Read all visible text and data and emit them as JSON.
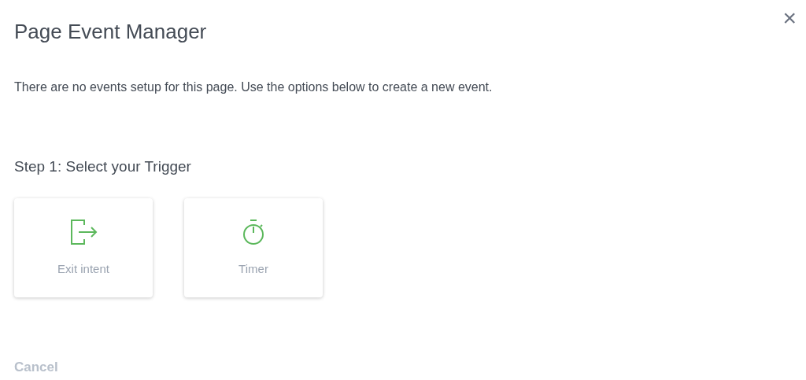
{
  "dialog": {
    "title": "Page Event Manager",
    "close": "×",
    "message": "There are no events setup for this page. Use the options below to create a new event."
  },
  "step": {
    "heading": "Step 1: Select your Trigger",
    "triggers": [
      {
        "kind": "exit",
        "label": "Exit intent"
      },
      {
        "kind": "timer",
        "label": "Timer"
      }
    ]
  },
  "footer": {
    "cancel": "Cancel"
  }
}
